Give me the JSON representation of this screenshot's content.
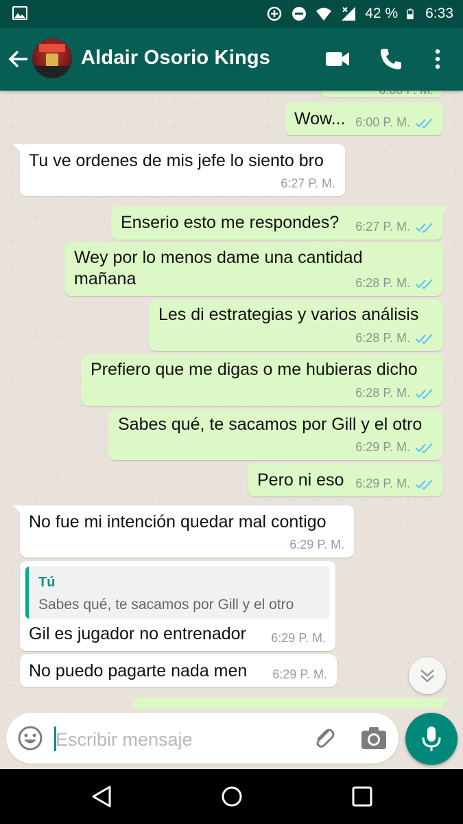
{
  "status_bar": {
    "battery": "42 %",
    "time": "6:33",
    "icons": [
      "gallery-icon",
      "data-saver-icon",
      "do-not-disturb-icon",
      "wifi-icon",
      "signal-icon",
      "battery-icon"
    ]
  },
  "header": {
    "contact_name": "Aldair Osorio Kings",
    "icons": [
      "back-arrow-icon",
      "video-call-icon",
      "phone-icon",
      "more-vert-icon"
    ]
  },
  "messages": [
    {
      "dir": "out",
      "text": "",
      "time": "6:00 P. M.",
      "partial": true
    },
    {
      "dir": "out",
      "text": "Wow...",
      "time": "6:00 P. M.",
      "read": true
    },
    {
      "dir": "in",
      "text": "Tu ve ordenes de mis jefe lo siento bro",
      "time": "6:27 P. M."
    },
    {
      "dir": "out",
      "text": "Enserio esto me respondes?",
      "time": "6:27 P. M.",
      "read": true
    },
    {
      "dir": "out",
      "text_lines": [
        "Wey por lo menos dame una cantidad",
        "mañana"
      ],
      "time": "6:28 P. M.",
      "read": true
    },
    {
      "dir": "out",
      "text": "Les di estrategias y varios análisis",
      "time": "6:28 P. M.",
      "read": true
    },
    {
      "dir": "out",
      "text": "Prefiero que me digas o me hubieras dicho",
      "time": "6:28 P. M.",
      "read": true
    },
    {
      "dir": "out",
      "text": "Sabes qué, te sacamos por Gill y el otro",
      "time": "6:29 P. M.",
      "read": true
    },
    {
      "dir": "out",
      "text": "Pero ni eso",
      "time": "6:29 P. M.",
      "read": true
    },
    {
      "dir": "in",
      "text": "No fue mi intención quedar mal contigo",
      "time": "6:29 P. M."
    },
    {
      "dir": "in",
      "quote": {
        "author": "Tú",
        "text": "Sabes qué, te sacamos por Gill y el otro"
      },
      "text": "Gil es jugador no entrenador",
      "time": "6:29 P. M."
    },
    {
      "dir": "in",
      "text": "No puedo pagarte nada men",
      "time": "6:29 P. M."
    },
    {
      "dir": "out",
      "text": "",
      "partial": true
    }
  ],
  "input": {
    "placeholder": "Escribir mensaje"
  },
  "colors": {
    "header": "#075e54",
    "status_bar": "#054d44",
    "outgoing_bubble": "#dcf8c6",
    "incoming_bubble": "#ffffff",
    "read_tick": "#4fc3f7",
    "accent": "#00897b"
  }
}
